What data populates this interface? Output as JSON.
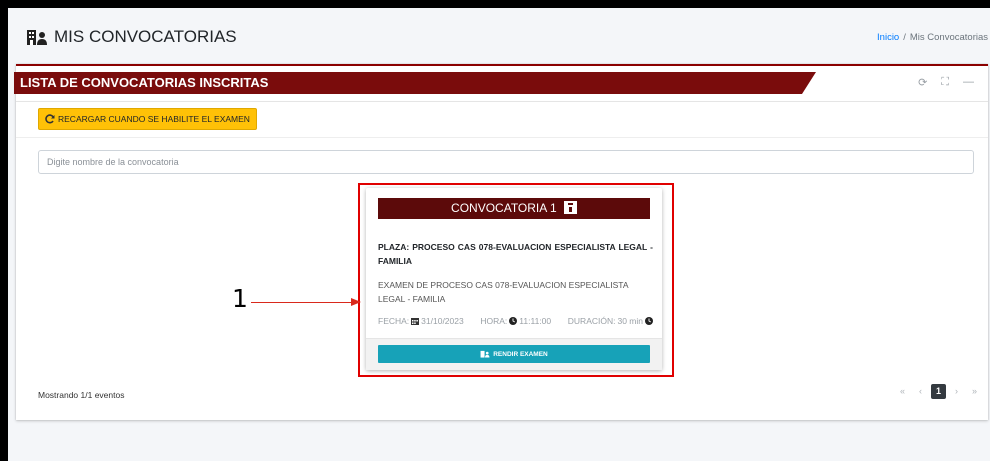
{
  "header": {
    "title": "MIS CONVOCATORIAS"
  },
  "breadcrumb": {
    "home": "Inicio",
    "separator": "/",
    "current": "Mis Convocatorias"
  },
  "card": {
    "title": "LISTA DE CONVOCATORIAS INSCRITAS",
    "reload_label": "RECARGAR CUANDO SE HABILITE EL EXAMEN",
    "search_placeholder": "Digite nombre de la convocatoria"
  },
  "exam": {
    "heading": "CONVOCATORIA 1",
    "plaza": "PLAZA: PROCESO CAS 078-EVALUACION ESPECIALISTA LEGAL - FAMILIA",
    "description": "EXAMEN DE PROCESO CAS 078-EVALUACION ESPECIALISTA LEGAL - FAMILIA",
    "fecha_label": "FECHA:",
    "fecha": "31/10/2023",
    "hora_label": "HORA:",
    "hora": "11:11:00",
    "duracion_label": "DURACIÓN:",
    "duracion": "30 min",
    "button_label": "RENDIR EXAMEN"
  },
  "annotation": {
    "number": "1"
  },
  "footer": {
    "showing": "Mostrando 1/1 eventos"
  },
  "pagination": {
    "first": "«",
    "prev": "‹",
    "current": "1",
    "next": "›",
    "last": "»"
  },
  "colors": {
    "brand": "#7a0c0c",
    "warning": "#ffc107",
    "info": "#17a2b8",
    "highlight": "#e00000"
  }
}
